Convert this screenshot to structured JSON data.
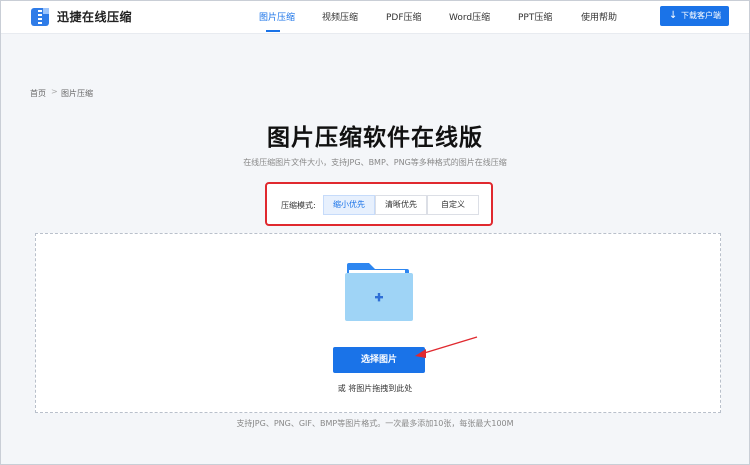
{
  "brand": {
    "name": "迅捷在线压缩",
    "logo": "zip-file-logo"
  },
  "nav": {
    "items": [
      {
        "label": "图片压缩",
        "active": true
      },
      {
        "label": "视频压缩"
      },
      {
        "label": "PDF压缩"
      },
      {
        "label": "Word压缩"
      },
      {
        "label": "PPT压缩"
      },
      {
        "label": "使用帮助"
      }
    ],
    "download": {
      "icon": "download-icon",
      "label": "下载客户端"
    }
  },
  "breadcrumb": {
    "home": "首页",
    "separator": ">",
    "current": "图片压缩"
  },
  "page": {
    "title": "图片压缩软件在线版",
    "subtitle": "在线压缩图片文件大小，支持JPG、BMP、PNG等多种格式的图片在线压缩"
  },
  "mode": {
    "label": "压缩模式:",
    "options": [
      "缩小优先",
      "清晰优先",
      "自定义"
    ],
    "selected": "缩小优先"
  },
  "upload": {
    "icon": "folder-add-icon",
    "button": "选择图片",
    "hint": "或 将图片拖拽到此处",
    "formats": "支持JPG、PNG、GIF、BMP等图片格式。一次最多添加10张，每张最大100M"
  },
  "colors": {
    "accent": "#1a73e8",
    "highlight": "#e0292f",
    "folder": "#9fd4f6"
  }
}
